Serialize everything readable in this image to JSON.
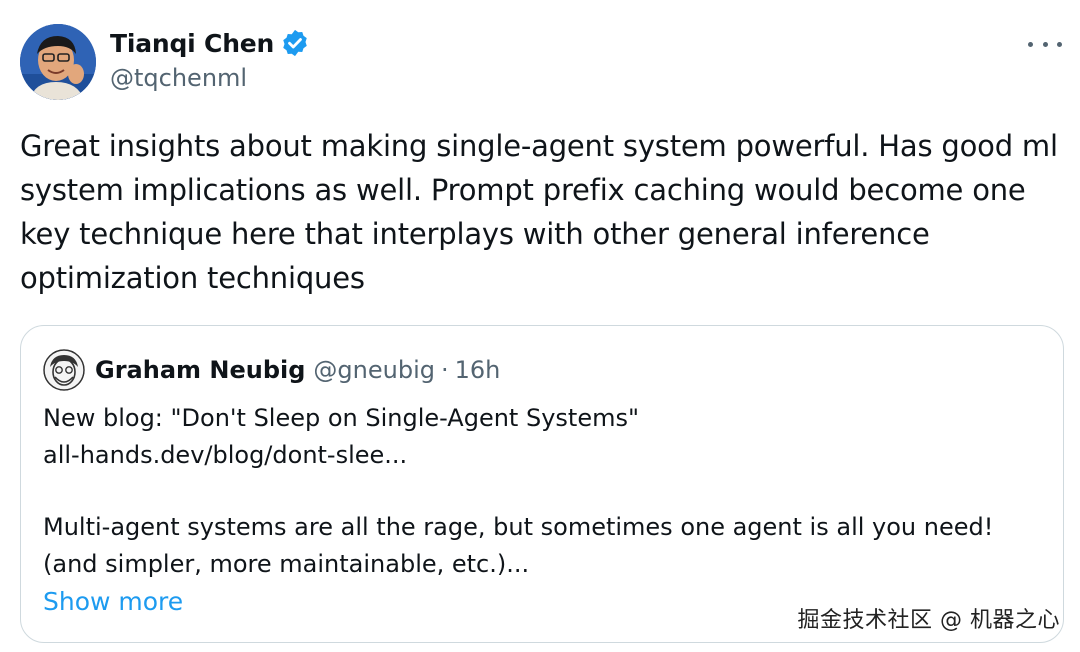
{
  "author": {
    "name": "Tianqi Chen",
    "handle": "@tqchenml",
    "verified_color": "#1d9bf0"
  },
  "tweet": {
    "text": "Great insights about making single-agent system powerful. Has good ml\nsystem implications as well. Prompt prefix caching would become one\nkey technique here that interplays with other general inference\noptimization techniques"
  },
  "quote": {
    "name": "Graham Neubig",
    "handle": "@gneubig",
    "separator": "·",
    "time": "16h",
    "lines": [
      "New blog: \"Don't Sleep on Single-Agent Systems\"",
      "all-hands.dev/blog/dont-slee...",
      "Multi-agent systems are all the rage, but sometimes one agent is all you need!",
      "(and simpler, more maintainable, etc.)..."
    ],
    "show_more": "Show more"
  },
  "watermark": "掘金技术社区 @ 机器之心",
  "icons": {
    "verified": "verified-badge-icon",
    "more": "more-dots-icon"
  }
}
